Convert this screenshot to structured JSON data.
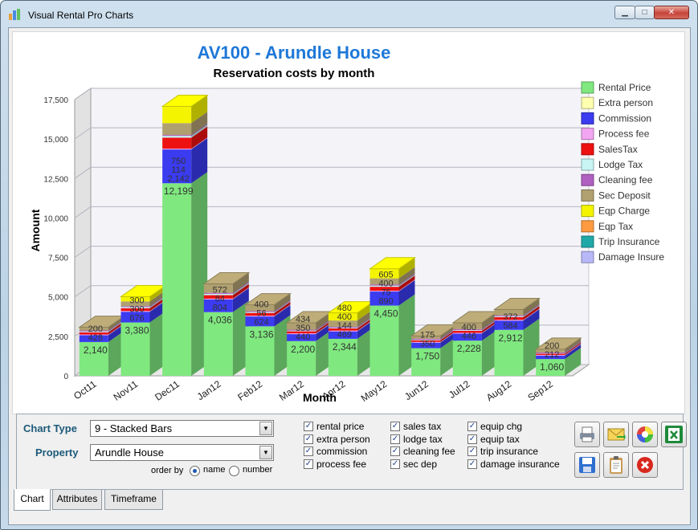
{
  "window": {
    "title": "Visual Rental Pro Charts"
  },
  "chart_data": {
    "type": "bar",
    "stacked": true,
    "title": "AV100 - Arundle House",
    "subtitle": "Reservation costs by month",
    "xlabel": "Month",
    "ylabel": "Amount",
    "ylim": [
      0,
      17500
    ],
    "ytick_labels": [
      "0",
      "2,500",
      "5,000",
      "7,500",
      "10,000",
      "12,500",
      "15,000",
      "17,500"
    ],
    "categories": [
      "Oct11",
      "Nov11",
      "Dec11",
      "Jan12",
      "Feb12",
      "Mar12",
      "Apr12",
      "May12",
      "Jun12",
      "Jul12",
      "Aug12",
      "Sep12"
    ],
    "legend_position": "right",
    "series": [
      {
        "name": "Rental Price",
        "color": "#7fe87f",
        "values": [
          2140,
          3380,
          12199,
          4036,
          3136,
          2200,
          2344,
          4450,
          1750,
          2228,
          2912,
          1060
        ]
      },
      {
        "name": "Extra person",
        "color": "#ffffb0",
        "values": [
          0,
          0,
          0,
          0,
          0,
          0,
          0,
          0,
          0,
          0,
          0,
          0
        ]
      },
      {
        "name": "Commission",
        "color": "#3b3bf0",
        "values": [
          428,
          676,
          2142,
          804,
          624,
          440,
          469,
          890,
          350,
          446,
          584,
          212
        ]
      },
      {
        "name": "Process fee",
        "color": "#f2a6f2",
        "values": [
          50,
          50,
          50,
          50,
          50,
          50,
          50,
          50,
          50,
          50,
          50,
          50
        ]
      },
      {
        "name": "SalesTax",
        "color": "#ee1111",
        "values": [
          140,
          180,
          694,
          220,
          172,
          130,
          138,
          250,
          105,
          130,
          168,
          80
        ]
      },
      {
        "name": "Lodge Tax",
        "color": "#c8f4f4",
        "values": [
          56,
          68,
          114,
          84,
          56,
          44,
          44,
          75,
          35,
          44,
          54,
          22
        ]
      },
      {
        "name": "Cleaning fee",
        "color": "#b060c0",
        "values": [
          60,
          60,
          60,
          60,
          60,
          60,
          60,
          60,
          60,
          60,
          60,
          60
        ]
      },
      {
        "name": "Sec Deposit",
        "color": "#b0a070",
        "values": [
          200,
          300,
          750,
          572,
          400,
          434,
          400,
          400,
          175,
          400,
          372,
          200
        ]
      },
      {
        "name": "Eqp Charge",
        "color": "#f4f400",
        "values": [
          0,
          300,
          1060,
          0,
          0,
          0,
          480,
          605,
          0,
          0,
          0,
          0
        ]
      },
      {
        "name": "Eqp Tax",
        "color": "#ff9a40",
        "values": [
          0,
          0,
          0,
          0,
          0,
          0,
          0,
          0,
          0,
          0,
          0,
          0
        ]
      },
      {
        "name": "Trip Insurance",
        "color": "#20a8a8",
        "values": [
          0,
          0,
          0,
          0,
          0,
          0,
          0,
          0,
          0,
          0,
          0,
          0
        ]
      },
      {
        "name": "Damage Insure",
        "color": "#b8b8f8",
        "values": [
          0,
          0,
          0,
          0,
          0,
          0,
          0,
          0,
          0,
          0,
          0,
          0
        ]
      }
    ],
    "data_labels": [
      {
        "category": "Oct11",
        "labels": [
          "2,140",
          "428",
          "200"
        ]
      },
      {
        "category": "Nov11",
        "labels": [
          "3,380",
          "676",
          "300",
          "300"
        ]
      },
      {
        "category": "Dec11",
        "labels": [
          "12,199",
          "2,142",
          "114",
          "750"
        ]
      },
      {
        "category": "Jan12",
        "labels": [
          "4,036",
          "804",
          "84",
          "572"
        ]
      },
      {
        "category": "Feb12",
        "labels": [
          "3,136",
          "624",
          "56",
          "400"
        ]
      },
      {
        "category": "Mar12",
        "labels": [
          "2,200",
          "440",
          "350",
          "434"
        ]
      },
      {
        "category": "Apr12",
        "labels": [
          "2,344",
          "469",
          "144",
          "400",
          "480"
        ]
      },
      {
        "category": "May12",
        "labels": [
          "4,450",
          "890",
          "75",
          "400",
          "605"
        ]
      },
      {
        "category": "Jun12",
        "labels": [
          "1,750",
          "350",
          "175"
        ]
      },
      {
        "category": "Jul12",
        "labels": [
          "2,228",
          "446",
          "400"
        ]
      },
      {
        "category": "Aug12",
        "labels": [
          "2,912",
          "584",
          "372"
        ]
      },
      {
        "category": "Sep12",
        "labels": [
          "1,060",
          "212",
          "200"
        ]
      }
    ]
  },
  "controls": {
    "chart_type_label": "Chart Type",
    "chart_type_value": "9 - Stacked Bars",
    "property_label": "Property",
    "property_value": "Arundle House",
    "order_by_label": "order by",
    "order_name": "name",
    "order_number": "number",
    "order_selected": "name",
    "checkboxes": [
      {
        "label": "rental price",
        "checked": true
      },
      {
        "label": "extra person",
        "checked": true
      },
      {
        "label": "commission",
        "checked": true
      },
      {
        "label": "process fee",
        "checked": true
      },
      {
        "label": "sales tax",
        "checked": true
      },
      {
        "label": "lodge tax",
        "checked": true
      },
      {
        "label": "cleaning fee",
        "checked": true
      },
      {
        "label": "sec dep",
        "checked": true
      },
      {
        "label": "equip chg",
        "checked": true
      },
      {
        "label": "equip tax",
        "checked": true
      },
      {
        "label": "trip insurance",
        "checked": true
      },
      {
        "label": "damage insurance",
        "checked": true
      }
    ],
    "tools": [
      "print-icon",
      "email-icon",
      "color-wheel-icon",
      "excel-icon",
      "save-icon",
      "clipboard-icon",
      "close-icon"
    ]
  },
  "tabs": [
    {
      "label": "Chart",
      "active": true
    },
    {
      "label": "Attributes",
      "active": false
    },
    {
      "label": "Timeframe",
      "active": false
    }
  ]
}
